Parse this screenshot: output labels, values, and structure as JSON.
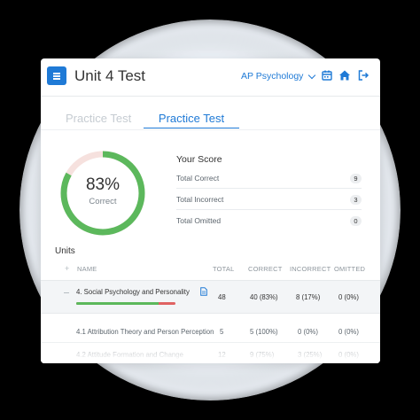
{
  "header": {
    "title": "Unit 4 Test",
    "course": "AP Psychology",
    "icons": [
      "menu-icon",
      "chevron-down-icon",
      "calendar-icon",
      "home-icon",
      "logout-icon"
    ]
  },
  "tabs": [
    {
      "label": "Practice Test",
      "active": false
    },
    {
      "label": "Practice Test",
      "active": true
    }
  ],
  "donut": {
    "percent_label": "83%",
    "percent": 83,
    "label": "Correct"
  },
  "score": {
    "title": "Your Score",
    "rows": [
      {
        "label": "Total Correct",
        "value": "9"
      },
      {
        "label": "Total Incorrect",
        "value": "3"
      },
      {
        "label": "Total Omitted",
        "value": "0"
      }
    ]
  },
  "units": {
    "title": "Units",
    "columns": {
      "name": "NAME",
      "total": "TOTAL",
      "correct": "CORRECT",
      "incorrect": "INCORRECT",
      "omitted": "OMITTED"
    },
    "rows": [
      {
        "name": "4. Social Psychology and Personality",
        "total": "48",
        "correct": "40 (83%)",
        "incorrect": "8 (17%)",
        "omitted": "0 (0%)",
        "correct_fraction": 0.83
      },
      {
        "name": "4.1 Attribution Theory and Person Perception",
        "total": "5",
        "correct": "5 (100%)",
        "incorrect": "0 (0%)",
        "omitted": "0 (0%)"
      },
      {
        "name": "4.2 Attitude Formation and Change",
        "total": "12",
        "correct": "9 (75%)",
        "incorrect": "3 (25%)",
        "omitted": "0 (0%)"
      }
    ]
  },
  "colors": {
    "accent": "#1f7ad6",
    "correct": "#5cb85c",
    "incorrect": "#e06262",
    "donut_track": "#f6e1de"
  }
}
